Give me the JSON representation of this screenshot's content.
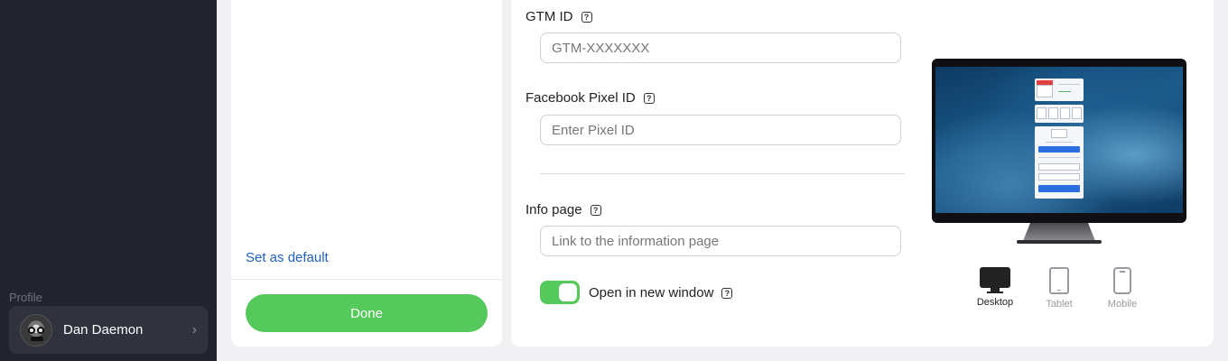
{
  "sidebar": {
    "profile_label": "Profile",
    "user_name": "Dan Daemon"
  },
  "left_panel": {
    "set_default_link": "Set as default",
    "done_button": "Done"
  },
  "settings": {
    "gtm": {
      "label": "GTM ID",
      "placeholder": "GTM-XXXXXXX",
      "value": ""
    },
    "facebook_pixel": {
      "label": "Facebook Pixel ID",
      "placeholder": "Enter Pixel ID",
      "value": ""
    },
    "info_page": {
      "label": "Info page",
      "placeholder": "Link to the information page",
      "value": ""
    },
    "open_new_window": {
      "label": "Open in new window",
      "enabled": true
    }
  },
  "preview": {
    "mini_widget": {
      "calendar_month": "August",
      "calendar_day": "10",
      "time": "00:00 AM",
      "countdown": [
        "03",
        "16",
        "55",
        "16"
      ],
      "countdown_units": [
        "days",
        "hours",
        "minutes",
        "seconds"
      ],
      "points": "100",
      "points_caption": "available points",
      "button": "Sign in"
    },
    "devices": [
      {
        "id": "desktop",
        "label": "Desktop",
        "active": true,
        "icon": "desktop-icon"
      },
      {
        "id": "tablet",
        "label": "Tablet",
        "active": false,
        "icon": "tablet-icon"
      },
      {
        "id": "mobile",
        "label": "Mobile",
        "active": false,
        "icon": "mobile-icon"
      }
    ]
  },
  "colors": {
    "accent_green": "#55c95c",
    "link_blue": "#1f5fbf",
    "sidebar_bg": "#23252e",
    "page_bg": "#f1f1f3"
  }
}
